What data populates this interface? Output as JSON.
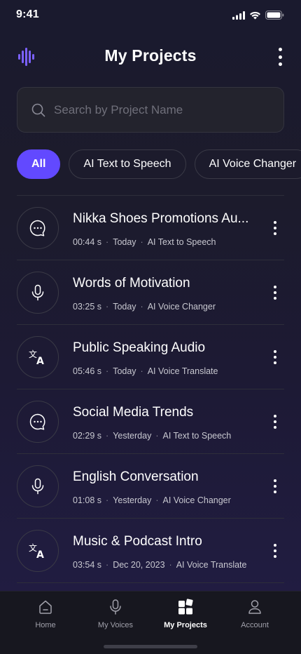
{
  "status_bar": {
    "time": "9:41"
  },
  "header": {
    "title": "My Projects"
  },
  "search": {
    "placeholder": "Search by Project Name"
  },
  "filters": [
    {
      "label": "All",
      "active": true
    },
    {
      "label": "AI Text to Speech",
      "active": false
    },
    {
      "label": "AI Voice Changer",
      "active": false
    }
  ],
  "projects": [
    {
      "title": "Nikka Shoes Promotions Au...",
      "duration": "00:44 s",
      "date": "Today",
      "type": "AI Text to Speech",
      "icon": "chat-bubble-icon"
    },
    {
      "title": "Words of Motivation",
      "duration": "03:25 s",
      "date": "Today",
      "type": "AI Voice Changer",
      "icon": "microphone-icon"
    },
    {
      "title": "Public Speaking Audio",
      "duration": "05:46 s",
      "date": "Today",
      "type": "AI Voice Translate",
      "icon": "translate-icon"
    },
    {
      "title": "Social Media Trends",
      "duration": "02:29 s",
      "date": "Yesterday",
      "type": "AI Text to Speech",
      "icon": "chat-bubble-icon"
    },
    {
      "title": "English Conversation",
      "duration": "01:08 s",
      "date": "Yesterday",
      "type": "AI Voice Changer",
      "icon": "microphone-icon"
    },
    {
      "title": "Music & Podcast Intro",
      "duration": "03:54 s",
      "date": "Dec 20, 2023",
      "type": "AI Voice Translate",
      "icon": "translate-icon"
    }
  ],
  "bottom_nav": [
    {
      "label": "Home",
      "icon": "home-icon",
      "active": false
    },
    {
      "label": "My Voices",
      "icon": "microphone-icon",
      "active": false
    },
    {
      "label": "My Projects",
      "icon": "grid-icon",
      "active": true
    },
    {
      "label": "Account",
      "icon": "user-icon",
      "active": false
    }
  ],
  "colors": {
    "accent": "#6249ff",
    "background": "#1c1b2c"
  }
}
